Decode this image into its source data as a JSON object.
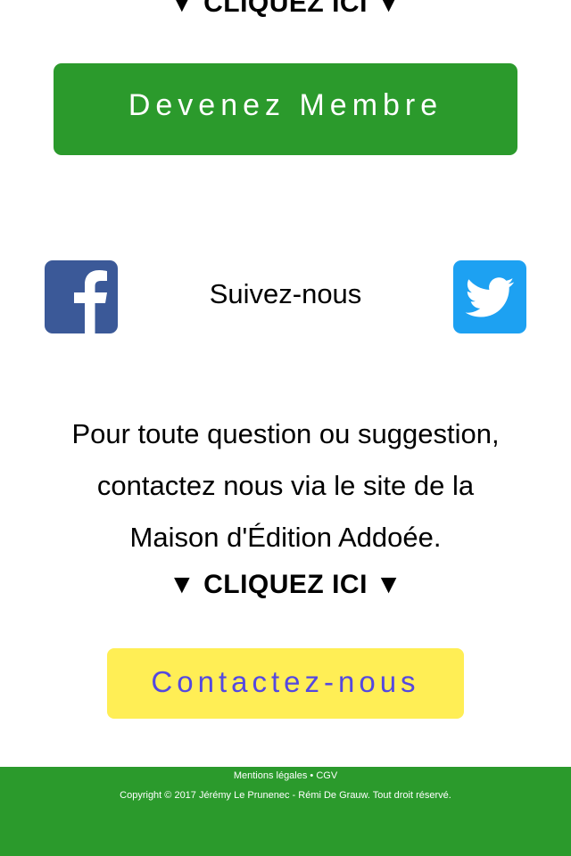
{
  "member_section": {
    "cta_text": "▼ CLIQUEZ ICI ▼",
    "button_label": "Devenez Membre",
    "button_color": "#2b9a2c"
  },
  "social": {
    "facebook_icon": "facebook-icon",
    "twitter_icon": "twitter-icon",
    "follow_label": "Suivez-nous"
  },
  "contact_section": {
    "text_line1": "Pour toute question ou suggestion,",
    "text_line2": "contactez nous via le site de la",
    "text_line3": "Maison d'Édition Addoée.",
    "cta_text": "▼ CLIQUEZ ICI ▼",
    "button_label": "Contactez-nous",
    "button_color": "#ffee55",
    "button_text_color": "#5448e0"
  },
  "footer": {
    "mentions_label": "Mentions légales",
    "separator": " • ",
    "cgv_label": "CGV",
    "copyright": "Copyright © 2017 Jérémy Le Prunenec - Rémi De Grauw. Tout droit réservé.",
    "background_color": "#2b9a2c"
  }
}
